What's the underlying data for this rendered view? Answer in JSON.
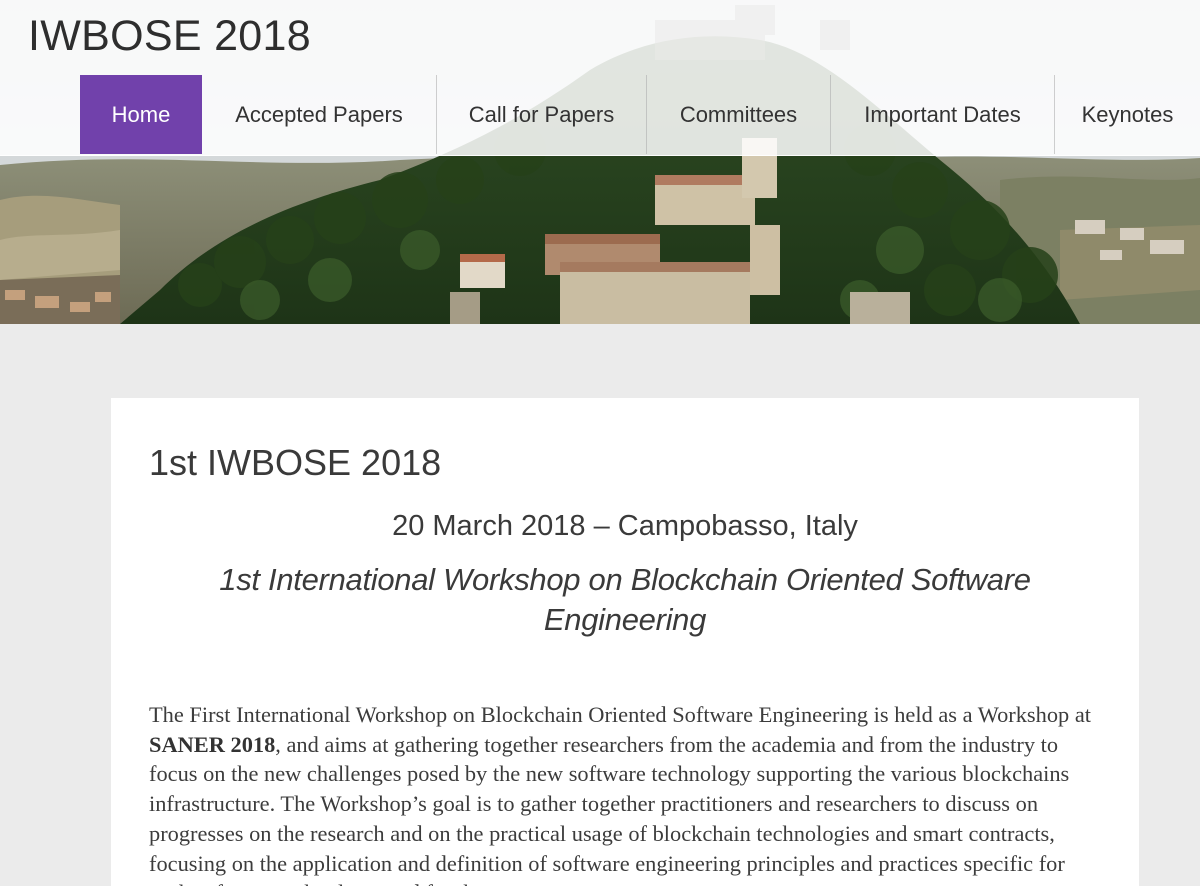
{
  "site": {
    "title": "IWBOSE 2018"
  },
  "nav": {
    "items": [
      {
        "label": "Home",
        "active": true
      },
      {
        "label": "Accepted Papers",
        "active": false
      },
      {
        "label": "Call for Papers",
        "active": false
      },
      {
        "label": "Committees",
        "active": false
      },
      {
        "label": "Important Dates",
        "active": false
      },
      {
        "label": "Keynotes",
        "active": false
      }
    ]
  },
  "content": {
    "title": "1st IWBOSE 2018",
    "date_location": "20 March 2018 – Campobasso, Italy",
    "event_name": "1st International Workshop on Blockchain Oriented Software Engineering",
    "intro_part1": "The First International Workshop on Blockchain Oriented Software Engineering is held as a Workshop at ",
    "intro_strong": "SANER 2018",
    "intro_part2": ", and aims at gathering together researchers from the academia and from the industry to focus on the new challenges posed by the new software technology supporting the various blockchains infrastructure. The Workshop’s goal is to gather together practitioners and researchers to discuss on progresses on the research and on the practical usage of blockchain technologies and smart contracts, focusing on the application and definition of software engineering principles and practices specific for such software technology, and for the"
  },
  "colors": {
    "accent": "#7141ab",
    "page_background": "#ebebeb",
    "card_background": "#ffffff",
    "text": "#3a3a3a"
  }
}
